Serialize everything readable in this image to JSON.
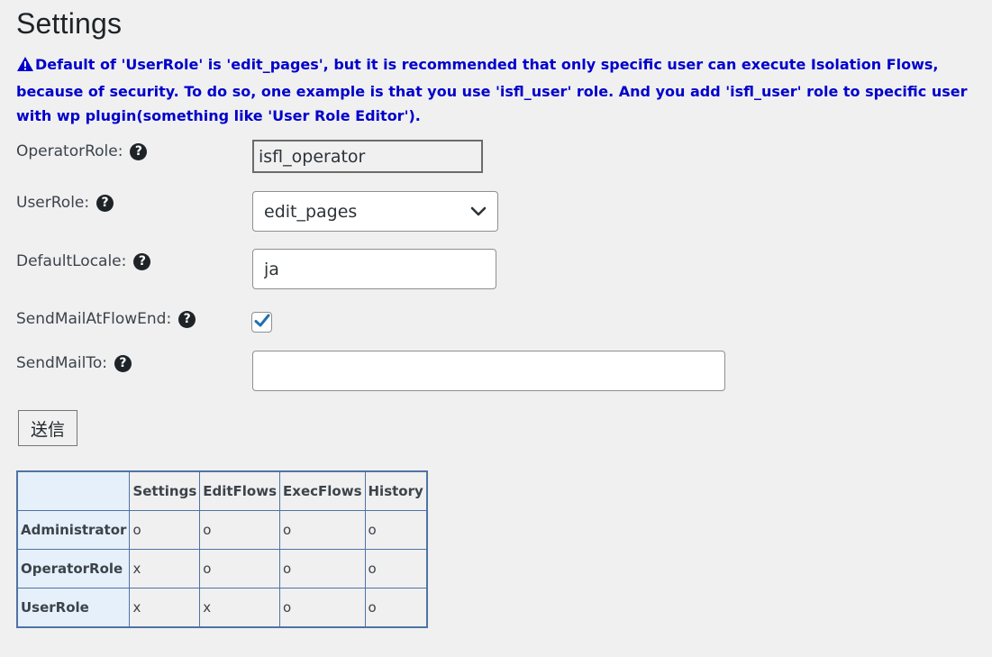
{
  "page": {
    "title": "Settings"
  },
  "warning": {
    "text": "Default of 'UserRole' is 'edit_pages', but it is recommended that only specific user can execute Isolation Flows, because of security. To do so, one example is that you use 'isfl_user' role. And you add 'isfl_user' role to specific user with wp plugin(something like 'User Role Editor').",
    "color": "#0000cc"
  },
  "form": {
    "operator_role": {
      "label": "OperatorRole:",
      "value": "isfl_operator"
    },
    "user_role": {
      "label": "UserRole:",
      "value": "edit_pages"
    },
    "default_locale": {
      "label": "DefaultLocale:",
      "value": "ja"
    },
    "send_mail_at_flow_end": {
      "label": "SendMailAtFlowEnd:",
      "checked": true
    },
    "send_mail_to": {
      "label": "SendMailTo:",
      "value": ""
    },
    "submit_label": "送信",
    "help_glyph": "?"
  },
  "permissions": {
    "headers": [
      "",
      "Settings",
      "EditFlows",
      "ExecFlows",
      "History"
    ],
    "rows": [
      {
        "role": "Administrator",
        "cells": [
          "o",
          "o",
          "o",
          "o"
        ]
      },
      {
        "role": "OperatorRole",
        "cells": [
          "x",
          "o",
          "o",
          "o"
        ]
      },
      {
        "role": "UserRole",
        "cells": [
          "x",
          "x",
          "o",
          "o"
        ]
      }
    ]
  },
  "colors": {
    "accent": "#2271b1",
    "table_border": "#4f73a3",
    "header_bg": "#e6f0fb"
  }
}
